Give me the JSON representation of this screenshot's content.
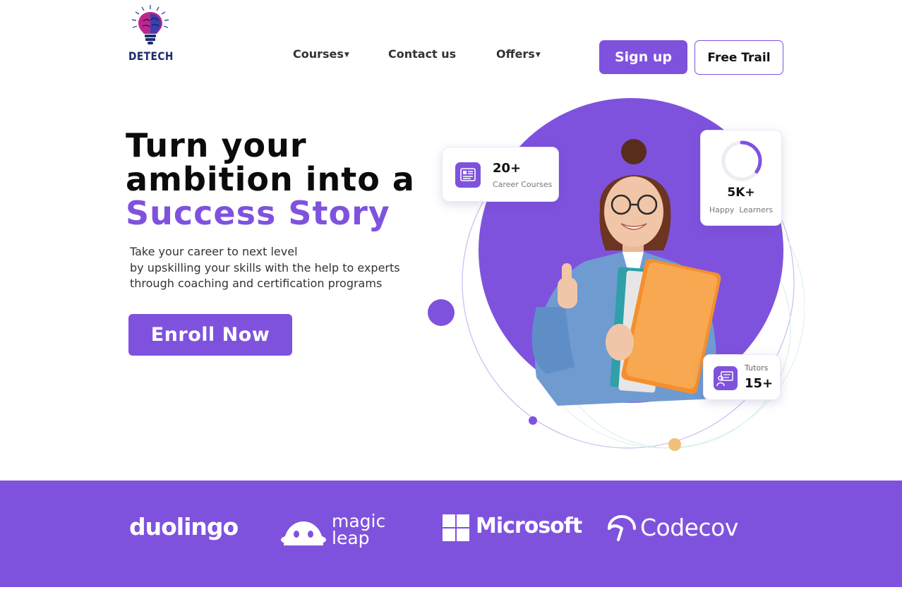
{
  "brand": {
    "name": "DETECH",
    "accent_color": "#7f52de",
    "logo_icon": "lightbulb-brain-icon"
  },
  "nav": {
    "courses_label": "Courses",
    "contact_label": "Contact us",
    "offers_label": "Offers",
    "dropdown_icon": "caret-down-icon"
  },
  "header_actions": {
    "signup_label": "Sign up",
    "trial_label": "Free Trail"
  },
  "hero": {
    "title_line1": "Turn your",
    "title_line2": "ambition into a",
    "title_accent": "Success Story",
    "subtitle_line1": "Take your career to next level",
    "subtitle_line2": "by upskilling your skills with the help to experts",
    "subtitle_line3": "through coaching and certification programs",
    "cta_label": "Enroll Now",
    "image": "student-with-books-photo"
  },
  "stats": {
    "courses": {
      "value": "20+",
      "label": "Career Courses",
      "icon": "certificate-icon"
    },
    "learners": {
      "value": "5K+",
      "label": "Happy  Learners",
      "icon": "progress-ring-icon",
      "progress_fraction": 0.35
    },
    "tutors": {
      "value": "15+",
      "label": "Tutors",
      "icon": "presenter-board-icon"
    }
  },
  "partners": {
    "duolingo": "duolingo",
    "magic_leap_line1": "magic",
    "magic_leap_line2": "leap",
    "microsoft": "Microsoft",
    "codecov": "Codecov"
  }
}
